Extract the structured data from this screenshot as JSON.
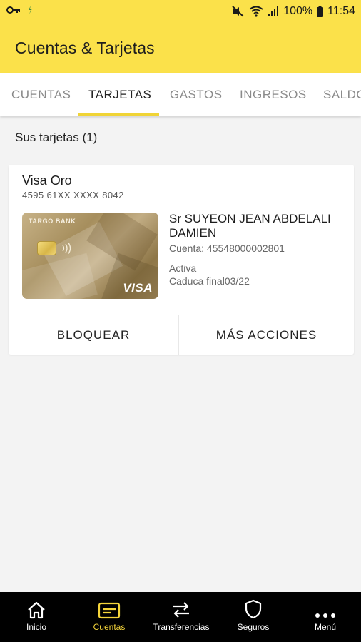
{
  "status_bar": {
    "battery": "100%",
    "time": "11:54"
  },
  "header": {
    "title": "Cuentas & Tarjetas"
  },
  "tabs": [
    {
      "label": "CUENTAS"
    },
    {
      "label": "TARJETAS"
    },
    {
      "label": "GASTOS"
    },
    {
      "label": "INGRESOS"
    },
    {
      "label": "SALDO"
    }
  ],
  "active_tab": "TARJETAS",
  "section": {
    "label": "Sus tarjetas (1)"
  },
  "card": {
    "name": "Visa Oro",
    "number": "4595 61XX XXXX 8042",
    "brand": "TARGO BANK",
    "network": "VISA",
    "holder": "Sr SUYEON JEAN ABDELALI DAMIEN",
    "account": "Cuenta: 45548000002801",
    "status": "Activa",
    "expiry": "Caduca final03/22",
    "actions": {
      "block": "BLOQUEAR",
      "more": "MÁS ACCIONES"
    }
  },
  "bottom_nav": [
    {
      "label": "Inicio",
      "icon": "home-icon"
    },
    {
      "label": "Cuentas",
      "icon": "card-icon"
    },
    {
      "label": "Transferencias",
      "icon": "transfer-icon"
    },
    {
      "label": "Seguros",
      "icon": "shield-icon"
    },
    {
      "label": "Menú",
      "icon": "more-icon"
    }
  ],
  "colors": {
    "header_yellow": "#fbe14a",
    "accent": "#f5d53a",
    "nav_bg": "#000000"
  }
}
